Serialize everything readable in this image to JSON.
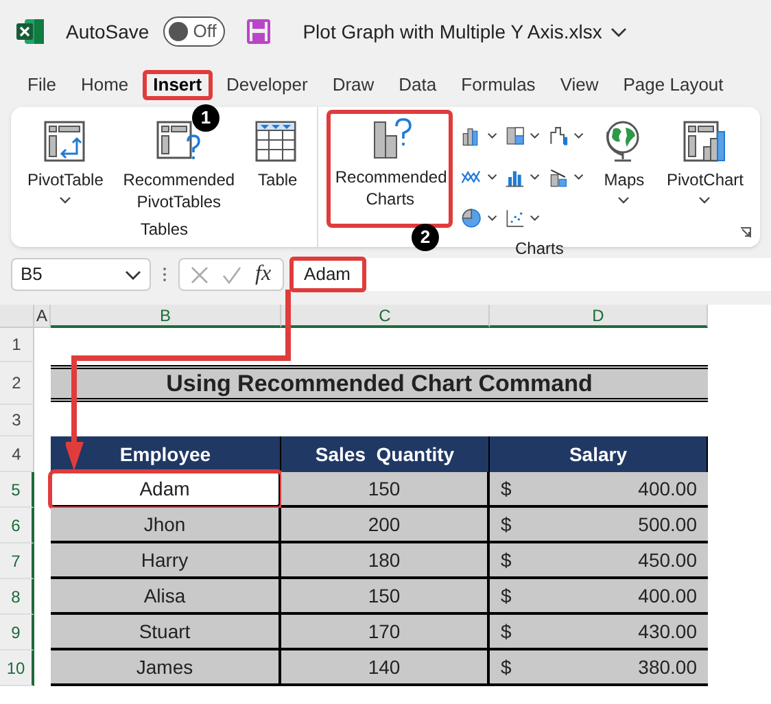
{
  "title_bar": {
    "autosave_label": "AutoSave",
    "autosave_toggle": {
      "label": "Off",
      "on": false
    },
    "file_name": "Plot Graph with Multiple Y Axis.xlsx"
  },
  "tabs": [
    {
      "label": "File",
      "selected": false
    },
    {
      "label": "Home",
      "selected": false
    },
    {
      "label": "Insert",
      "selected": true,
      "highlighted": true,
      "step": "1"
    },
    {
      "label": "Developer",
      "selected": false
    },
    {
      "label": "Draw",
      "selected": false
    },
    {
      "label": "Data",
      "selected": false
    },
    {
      "label": "Formulas",
      "selected": false
    },
    {
      "label": "View",
      "selected": false
    },
    {
      "label": "Page Layout",
      "selected": false
    }
  ],
  "ribbon": {
    "groups": [
      {
        "label": "Tables",
        "commands": [
          {
            "kind": "pivot",
            "label": "PivotTable",
            "dropdown": true
          },
          {
            "kind": "recpivot",
            "label": "Recommended PivotTables"
          },
          {
            "kind": "table",
            "label": "Table"
          }
        ]
      },
      {
        "label": "Charts",
        "launcher": true,
        "commands": [
          {
            "kind": "recchart",
            "label": "Recommended Charts",
            "highlighted": true,
            "step": "2"
          },
          {
            "kind": "gallery"
          },
          {
            "kind": "maps",
            "label": "Maps",
            "dropdown": true
          },
          {
            "kind": "pivotchart",
            "label": "PivotChart",
            "dropdown": true
          }
        ]
      }
    ]
  },
  "formula_bar": {
    "name_box": "B5",
    "fx": "fx",
    "value": "Adam",
    "highlighted": true
  },
  "columns": [
    {
      "label": "A",
      "selected": false
    },
    {
      "label": "B",
      "selected": true
    },
    {
      "label": "C",
      "selected": true
    },
    {
      "label": "D",
      "selected": true
    }
  ],
  "row_numbers": [
    {
      "label": "1",
      "selected": false
    },
    {
      "label": "2",
      "selected": false
    },
    {
      "label": "3",
      "selected": false
    },
    {
      "label": "4",
      "selected": false
    },
    {
      "label": "5",
      "selected": true
    },
    {
      "label": "6",
      "selected": true
    },
    {
      "label": "7",
      "selected": true
    },
    {
      "label": "8",
      "selected": true
    },
    {
      "label": "9",
      "selected": true
    },
    {
      "label": "10",
      "selected": true
    }
  ],
  "sheet": {
    "title": "Using Recommended Chart Command",
    "headers": [
      "Employee",
      "Sales  Quantity",
      "Salary"
    ],
    "rows": [
      {
        "employee": "Adam",
        "quantity": "150",
        "currency": "$",
        "salary": "400.00",
        "active": true,
        "highlighted": true
      },
      {
        "employee": "Jhon",
        "quantity": "200",
        "currency": "$",
        "salary": "500.00",
        "active": false
      },
      {
        "employee": "Harry",
        "quantity": "180",
        "currency": "$",
        "salary": "450.00",
        "active": false
      },
      {
        "employee": "Alisa",
        "quantity": "150",
        "currency": "$",
        "salary": "400.00",
        "active": false
      },
      {
        "employee": "Stuart",
        "quantity": "170",
        "currency": "$",
        "salary": "430.00",
        "active": false
      },
      {
        "employee": "James",
        "quantity": "140",
        "currency": "$",
        "salary": "380.00",
        "active": false
      }
    ]
  }
}
